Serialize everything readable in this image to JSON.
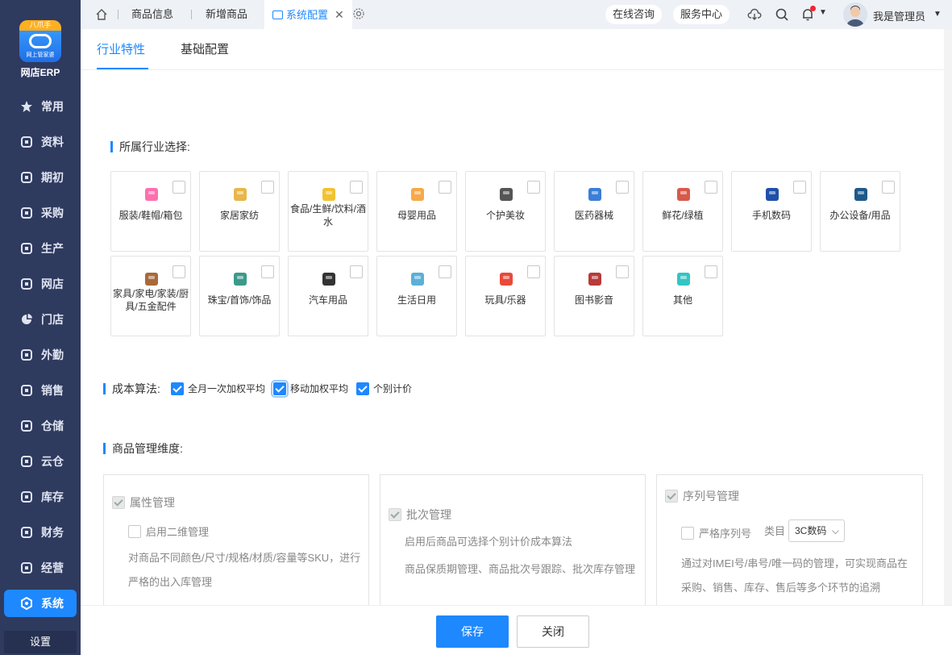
{
  "app": {
    "name": "网店ERP",
    "logo_badge": "八爪手",
    "logo_sub": "网上管家婆"
  },
  "sidebar": {
    "items": [
      {
        "label": "常用",
        "icon": "star-icon"
      },
      {
        "label": "资料",
        "icon": "document-icon"
      },
      {
        "label": "期初",
        "icon": "target-icon"
      },
      {
        "label": "采购",
        "icon": "purchase-icon"
      },
      {
        "label": "生产",
        "icon": "production-icon"
      },
      {
        "label": "网店",
        "icon": "store-icon"
      },
      {
        "label": "门店",
        "icon": "pie-icon"
      },
      {
        "label": "外勤",
        "icon": "field-icon"
      },
      {
        "label": "销售",
        "icon": "sales-icon"
      },
      {
        "label": "仓储",
        "icon": "warehouse-icon"
      },
      {
        "label": "云仓",
        "icon": "cloud-warehouse-icon"
      },
      {
        "label": "库存",
        "icon": "inventory-icon"
      },
      {
        "label": "财务",
        "icon": "finance-icon"
      },
      {
        "label": "经营",
        "icon": "business-icon"
      },
      {
        "label": "系统",
        "icon": "system-icon"
      }
    ],
    "settings_label": "设置"
  },
  "topbar": {
    "tabs": [
      {
        "label": "商品信息"
      },
      {
        "label": "新增商品"
      },
      {
        "label": "系统配置"
      }
    ],
    "online_consult": "在线咨询",
    "service_center": "服务中心",
    "username": "我是管理员"
  },
  "subtabs": [
    {
      "label": "行业特性"
    },
    {
      "label": "基础配置"
    }
  ],
  "industry": {
    "title": "所属行业选择:",
    "items": [
      {
        "label": "服装/鞋帽/箱包",
        "color": "#ff6fae"
      },
      {
        "label": "家居家纺",
        "color": "#e8b64a"
      },
      {
        "label": "食品/生鲜/饮料/酒水",
        "color": "#f2c233"
      },
      {
        "label": "母婴用品",
        "color": "#f6a94a"
      },
      {
        "label": "个护美妆",
        "color": "#555555"
      },
      {
        "label": "医药器械",
        "color": "#3b7ed8"
      },
      {
        "label": "鲜花/绿植",
        "color": "#d65a4a"
      },
      {
        "label": "手机数码",
        "color": "#1f4fa8"
      },
      {
        "label": "办公设备/用品",
        "color": "#1d5a8a"
      },
      {
        "label": "家具/家电/家装/厨具/五金配件",
        "color": "#a8693a"
      },
      {
        "label": "珠宝/首饰/饰品",
        "color": "#3a9a8a"
      },
      {
        "label": "汽车用品",
        "color": "#333333"
      },
      {
        "label": "生活日用",
        "color": "#5ab0d8"
      },
      {
        "label": "玩具/乐器",
        "color": "#e84a3a"
      },
      {
        "label": "图书影音",
        "color": "#b83a3a"
      },
      {
        "label": "其他",
        "color": "#35c4c4"
      }
    ]
  },
  "cost": {
    "title": "成本算法:",
    "options": [
      {
        "label": "全月一次加权平均",
        "checked": true
      },
      {
        "label": "移动加权平均",
        "checked": true
      },
      {
        "label": "个别计价",
        "checked": true
      }
    ]
  },
  "dimension": {
    "title": "商品管理维度:",
    "attr": {
      "title": "属性管理",
      "sub_option": "启用二维管理",
      "desc1": "对商品不同颜色/尺寸/规格/材质/容量等SKU，进行",
      "desc2": "严格的出入库管理"
    },
    "batch": {
      "title": "批次管理",
      "desc1": "启用后商品可选择个别计价成本算法",
      "desc2": "商品保质期管理、商品批次号跟踪、批次库存管理"
    },
    "serial": {
      "title": "序列号管理",
      "sub_option": "严格序列号",
      "category_label": "类目",
      "category_value": "3C数码",
      "desc1": "通过对IMEI号/串号/唯一码的管理，可实现商品在",
      "desc2": "采购、销售、库存、售后等多个环节的追溯"
    }
  },
  "footer": {
    "save": "保存",
    "close": "关闭"
  }
}
